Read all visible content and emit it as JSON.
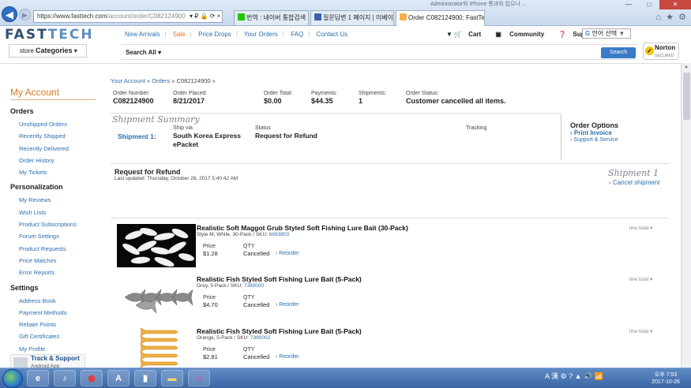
{
  "browser": {
    "address": "https://www.fasttech.com/account/order/C082124900",
    "address_host": "https://www.fasttech.com",
    "address_path": "/account/order/C082124900",
    "address_tools": "▾ ₽ 🔒 ⟳ ×",
    "tabs": [
      {
        "label": "번역 : 네이버 통합검색",
        "color": "#1ec800"
      },
      {
        "label": "질문답변 1 페이지 | 이베이프...",
        "color": "#3a5fa8"
      },
      {
        "label": "Order C082124900: FastTe...",
        "color": "#f4b04a"
      }
    ],
    "window_title": "Administrator와 iPhone 통과와 있으나 ...",
    "window_controls": {
      "min": "—",
      "max": "□",
      "close": "✕"
    },
    "right_icons": [
      "home-icon",
      "star-icon",
      "gear-icon"
    ]
  },
  "site": {
    "logo_a": "FAST",
    "logo_b": "TECH",
    "nav": [
      "New Arrivals",
      "Sale",
      "Price Drops",
      "Your Orders",
      "FAQ",
      "Contact Us"
    ],
    "cart": "Cart",
    "community": "Community",
    "support": "Support",
    "lang": "언어 선택",
    "lang_arrow": "▼",
    "store_label": "store",
    "categories": "Categories",
    "search_all": "Search All",
    "search_btn": "Search",
    "norton_title": "Norton",
    "norton_sub": "SECURED"
  },
  "sidebar": {
    "title": "My Account",
    "sections": [
      {
        "heading": "Orders",
        "items": [
          "Unshipped Orders",
          "Recently Shipped",
          "Recently Delivered",
          "Order History",
          "My Tickets"
        ]
      },
      {
        "heading": "Personalization",
        "items": [
          "My Reviews",
          "Wish Lists",
          "Product Subscriptions",
          "Forum Settings",
          "Product Requests",
          "Price Matches",
          "Error Reports"
        ]
      },
      {
        "heading": "Settings",
        "items": [
          "Address Book",
          "Payment Methods",
          "Rebate Points",
          "Gift Certificates",
          "My Profile"
        ]
      }
    ],
    "track_title": "Track & Support",
    "track_sub": "Android App"
  },
  "breadcrumb": {
    "a": "Your Account",
    "b": "Orders",
    "c": "C082124900",
    "sep": "»"
  },
  "order": {
    "number_label": "Order Number:",
    "number": "C082124900",
    "placed_label": "Order Placed:",
    "placed": "8/21/2017",
    "total_label": "Order Total:",
    "total": "$0.00",
    "payments_label": "Payments:",
    "payments": "$44.35",
    "shipments_label": "Shipments:",
    "shipments": "1",
    "status_label": "Order Status:",
    "status": "Customer cancelled all items."
  },
  "shipment": {
    "summary_title": "Shipment Summary",
    "name": "Shipment 1:",
    "ship_via_label": "Ship via",
    "ship_via": "South Korea Express ePacket",
    "status_label": "Status",
    "status": "Request for Refund",
    "tracking_label": "Tracking"
  },
  "order_options": {
    "title": "Order Options",
    "print": "› Print Invoice",
    "support": "› Support & Service"
  },
  "refund": {
    "title": "Request for Refund",
    "updated": "Last updated: Thursday, October 26, 2017 5:40:42 AM",
    "shipment": "Shipment 1",
    "cancel": "› Cancel shipment"
  },
  "items": [
    {
      "title": "Realistic Soft Maggot Grub Styled Soft Fishing Lure Bait (30-Pack)",
      "sku_prefix": "Style M, White, 30-Pack / SKU: ",
      "sku": "6693803",
      "price_label": "Price",
      "price": "$1.28",
      "qty_label": "QTY",
      "qty": "Cancelled",
      "reorder": "› Reorder",
      "line_total": "line total ▾"
    },
    {
      "title": "Realistic Fish Styled Soft Fishing Lure Bait (5-Pack)",
      "sku_prefix": "Grey, 5-Pack / SKU: ",
      "sku": "7380000",
      "price_label": "Price",
      "price": "$4.70",
      "qty_label": "QTY",
      "qty": "Cancelled",
      "reorder": "› Reorder",
      "line_total": "line total ▾"
    },
    {
      "title": "Realistic Fish Styled Soft Fishing Lure Bait (5-Pack)",
      "sku_prefix": "Orange, 5-Pack / SKU: ",
      "sku": "7380002",
      "price_label": "Price",
      "price": "$2.81",
      "qty_label": "QTY",
      "qty": "Cancelled",
      "reorder": "› Reorder",
      "line_total": "line total ▾"
    }
  ],
  "taskbar": {
    "apps": [
      "ie-icon",
      "tiktok-icon",
      "chrome-icon",
      "excel-icon",
      "phone-icon",
      "folder-icon",
      "itunes-icon"
    ],
    "tray": "A 漢 ⚙ ? ▲ 🔊 📶",
    "time": "오후 7:53",
    "date": "2017-10-26"
  },
  "colors": {
    "accent": "#2a6db0",
    "orange": "#e07a20",
    "search_btn": "#3a7bc8"
  }
}
